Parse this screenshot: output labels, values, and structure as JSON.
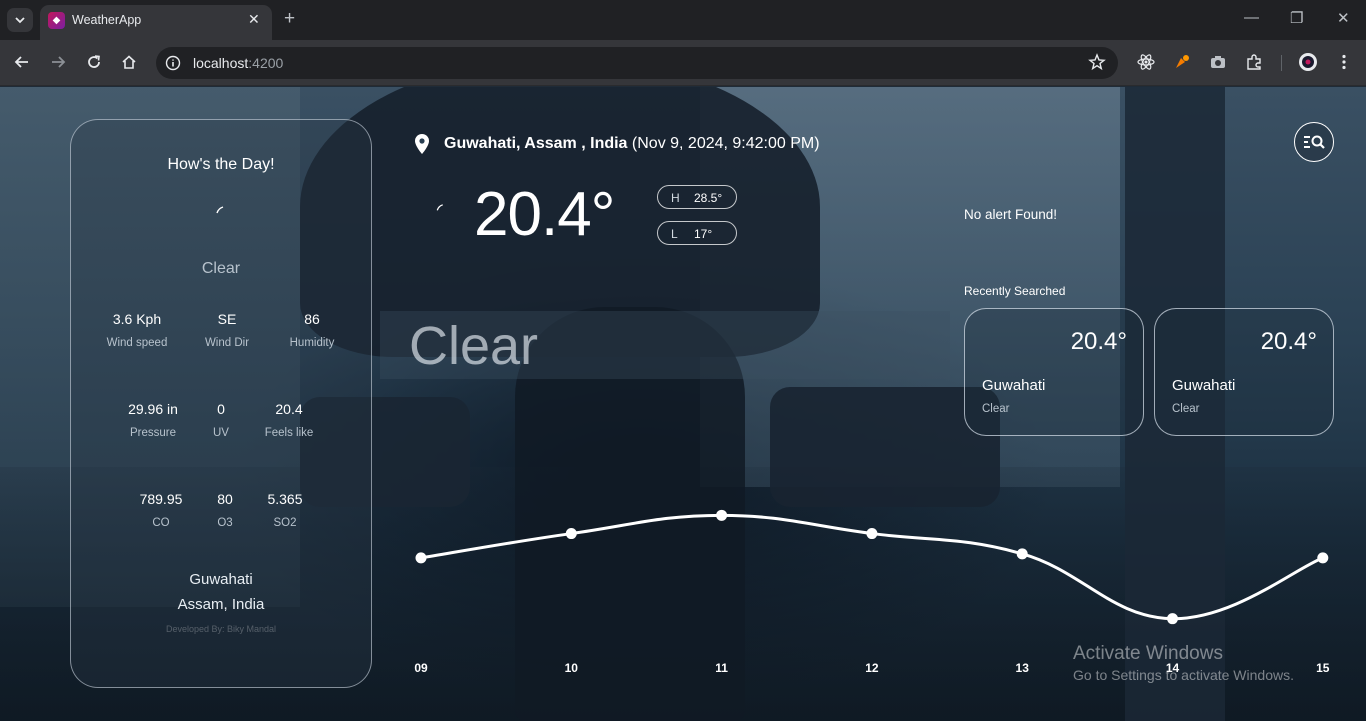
{
  "browser": {
    "tab_title": "WeatherApp",
    "url_host": "localhost",
    "url_port": ":4200"
  },
  "sidebar": {
    "heading": "How's the Day!",
    "condition": "Clear",
    "stats": [
      {
        "value": "3.6 Kph",
        "label": "Wind speed"
      },
      {
        "value": "SE",
        "label": "Wind Dir"
      },
      {
        "value": "86",
        "label": "Humidity"
      },
      {
        "value": "29.96 in",
        "label": "Pressure"
      },
      {
        "value": "0",
        "label": "UV"
      },
      {
        "value": "20.4",
        "label": "Feels like"
      },
      {
        "value": "789.95",
        "label": "CO"
      },
      {
        "value": "80",
        "label": "O3"
      },
      {
        "value": "5.365",
        "label": "SO2"
      }
    ],
    "city": "Guwahati",
    "state": "Assam, India",
    "developer": "Developed By: Biky Mandal"
  },
  "current": {
    "location": "Guwahati, Assam , India",
    "datetime": "(Nov 9, 2024, 9:42:00 PM)",
    "temperature": "20.4°",
    "high_label": "H",
    "high_value": "28.5°",
    "low_label": "L",
    "low_value": "17°",
    "condition": "Clear"
  },
  "alerts": {
    "text": "No alert Found!"
  },
  "recent": {
    "title": "Recently Searched",
    "items": [
      {
        "temp": "20.4°",
        "city": "Guwahati",
        "condition": "Clear"
      },
      {
        "temp": "20.4°",
        "city": "Guwahati",
        "condition": "Clear"
      }
    ]
  },
  "chart_data": {
    "type": "line",
    "categories": [
      "09",
      "10",
      "11",
      "12",
      "13",
      "14",
      "15"
    ],
    "series": [
      {
        "values": [
          20.4,
          22.8,
          24.6,
          22.8,
          20.8,
          14.4,
          20.4
        ]
      }
    ],
    "ylim": [
      12,
      27
    ],
    "title": "",
    "xlabel": "",
    "ylabel": "",
    "grid": false
  },
  "windows_notice": {
    "title": "Activate Windows",
    "subtitle": "Go to Settings to activate Windows."
  },
  "colors": {
    "moon": "#3f8ff0",
    "card_border": "#dce6f0"
  }
}
